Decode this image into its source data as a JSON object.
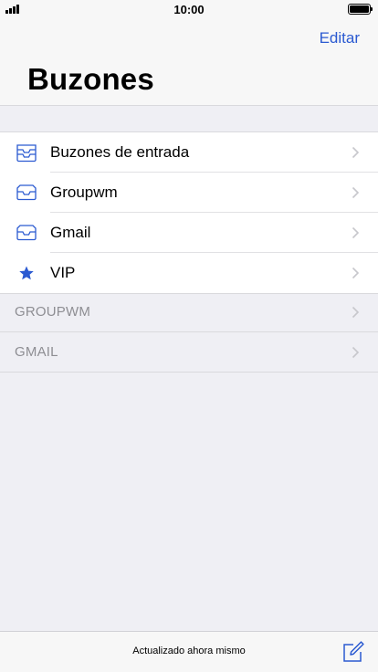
{
  "status_bar": {
    "time": "10:00"
  },
  "header": {
    "edit_label": "Editar",
    "title": "Buzones"
  },
  "mailboxes": [
    {
      "label": "Buzones de entrada",
      "icon": "inbox-tray-icon"
    },
    {
      "label": "Groupwm",
      "icon": "inbox-icon"
    },
    {
      "label": "Gmail",
      "icon": "inbox-icon"
    },
    {
      "label": "VIP",
      "icon": "star-icon"
    }
  ],
  "accounts": [
    {
      "label": "GROUPWM"
    },
    {
      "label": "GMAIL"
    }
  ],
  "toolbar": {
    "status": "Actualizado ahora mismo",
    "compose_icon": "compose-icon"
  },
  "colors": {
    "accent": "#2b5ad1",
    "background": "#efeff4",
    "secondary_text": "#8e8e93"
  }
}
